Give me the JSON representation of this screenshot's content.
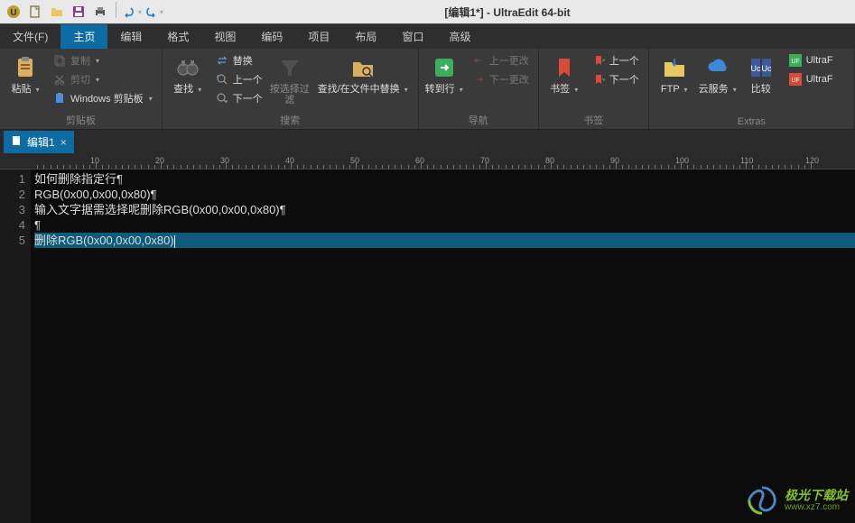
{
  "window": {
    "title": "[编辑1*] - UltraEdit 64-bit"
  },
  "menutabs": [
    {
      "label": "文件(F)",
      "active": false
    },
    {
      "label": "主页",
      "active": true
    },
    {
      "label": "编辑",
      "active": false
    },
    {
      "label": "格式",
      "active": false
    },
    {
      "label": "视图",
      "active": false
    },
    {
      "label": "编码",
      "active": false
    },
    {
      "label": "项目",
      "active": false
    },
    {
      "label": "布局",
      "active": false
    },
    {
      "label": "窗口",
      "active": false
    },
    {
      "label": "高级",
      "active": false
    }
  ],
  "ribbon": {
    "clipboard": {
      "label": "剪贴板",
      "paste": "粘贴",
      "copy": "复制",
      "cut": "剪切",
      "winclip": "Windows 剪贴板"
    },
    "search": {
      "label": "搜索",
      "find": "查找",
      "replace": "替换",
      "prev": "上一个",
      "next": "下一个",
      "filter": "按选择过滤",
      "findfiles": "查找/在文件中替换"
    },
    "nav": {
      "label": "导航",
      "goto": "转到行",
      "prevchange": "上一更改",
      "nextchange": "下一更改"
    },
    "bookmarks": {
      "label": "书签",
      "bookmark": "书签",
      "prev": "上一个",
      "next": "下一个"
    },
    "extras": {
      "label": "Extras",
      "ftp": "FTP",
      "cloud": "云服务",
      "compare": "比较",
      "ultraf1": "UltraF",
      "ultraf2": "UltraF"
    }
  },
  "doctab": {
    "name": "编辑1"
  },
  "ruler": {
    "ticks": [
      10,
      20,
      30,
      40,
      50,
      60,
      70,
      80,
      90,
      100,
      110,
      120
    ]
  },
  "code": {
    "lines": [
      "如何删除指定行¶",
      "RGB(0x00,0x00,0x80)¶",
      "输入文字据需选择呢删除RGB(0x00,0x00,0x80)¶",
      "¶",
      "删除RGB(0x00,0x00,0x80)"
    ],
    "selected_line": 5
  },
  "watermark": {
    "name": "极光下载站",
    "url": "www.xz7.com"
  }
}
